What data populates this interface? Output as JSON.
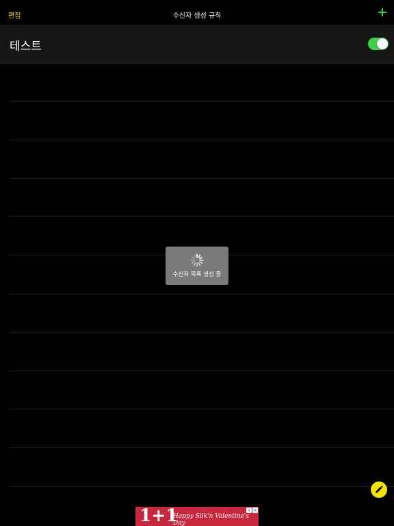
{
  "navbar": {
    "edit_label": "편집",
    "title": "수신자 생성 규칙",
    "add_icon": "plus-icon"
  },
  "rule": {
    "name": "테스트",
    "enabled": true
  },
  "loading": {
    "text": "수신자 목록 생성 중"
  },
  "fab": {
    "icon": "pencil-icon"
  },
  "ad": {
    "big_text": "1+1",
    "sub_text": "Happy Silk'n Valentine's Day",
    "info_icon": "info-icon",
    "close_icon": "close-icon"
  },
  "colors": {
    "accent_yellow": "#e6d700",
    "accent_green": "#36d14a",
    "fab": "#f5e400",
    "ad_bg": "#c8283d"
  }
}
